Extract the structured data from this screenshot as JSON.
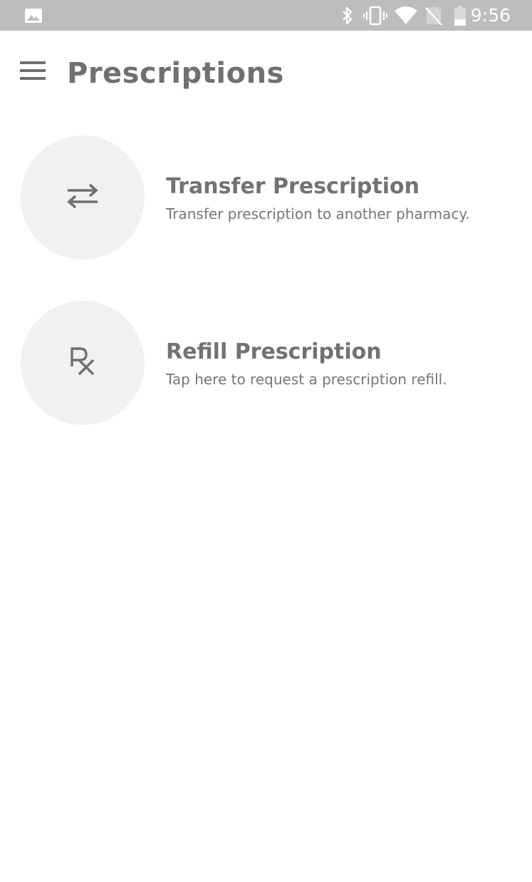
{
  "status_bar": {
    "time": "9:56",
    "icons": [
      "image-icon",
      "bluetooth-icon",
      "vibrate-icon",
      "wifi-icon",
      "no-sim-icon",
      "battery-icon"
    ]
  },
  "app_bar": {
    "title": "Prescriptions",
    "menu_icon": "menu-icon"
  },
  "actions": [
    {
      "icon": "swap-arrows-icon",
      "title": "Transfer Prescription",
      "subtitle": "Transfer prescription to another pharmacy."
    },
    {
      "icon": "rx-icon",
      "title": "Refill Prescription",
      "subtitle": "Tap here to request a prescription refill."
    }
  ],
  "colors": {
    "status_bar": "#bdbdbd",
    "text": "#707070",
    "circle": "#f1f1f1"
  }
}
